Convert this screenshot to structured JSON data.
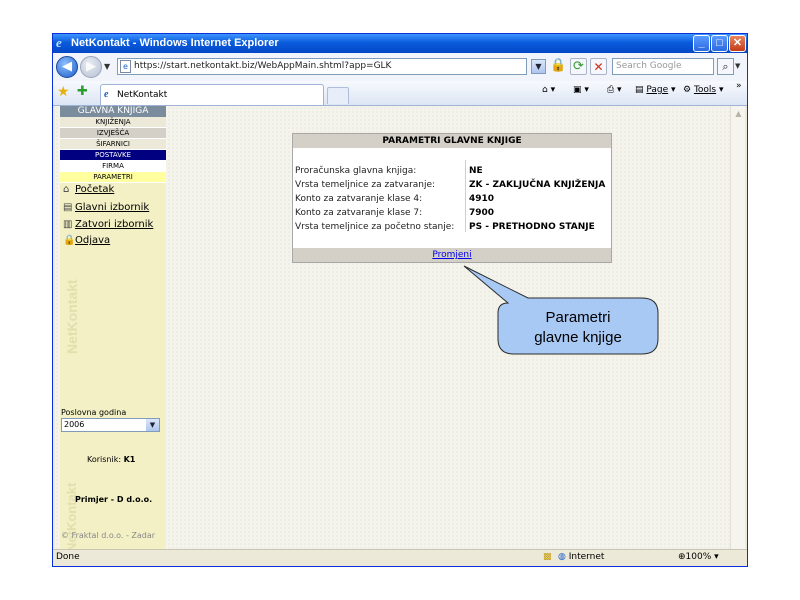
{
  "window": {
    "title": "NetKontakt - Windows Internet Explorer",
    "minimize": "_",
    "maximize": "□",
    "close": "✕"
  },
  "addressbar": {
    "url": "https://start.netkontakt.biz/WebAppMain.shtml?app=GLK",
    "search_placeholder": "Search Google"
  },
  "tabs": [
    {
      "label": "NetKontakt"
    }
  ],
  "commandbar": {
    "page_label": "Page",
    "tools_label": "Tools"
  },
  "sidebar": {
    "menu_header": "GLAVNA KNJIGA",
    "menu_items": [
      {
        "label": "KNJIŽENJA",
        "bg": "#ece9d8",
        "fg": "#000000"
      },
      {
        "label": "IZVJEŠĆA",
        "bg": "#d4d0c8",
        "fg": "#000000"
      },
      {
        "label": "ŠIFARNICI",
        "bg": "#ece9d8",
        "fg": "#000000"
      },
      {
        "label": "POSTAVKE",
        "bg": "#000080",
        "fg": "#ffffff"
      },
      {
        "label": "FIRMA",
        "bg": "#ffffff",
        "fg": "#000000"
      },
      {
        "label": "PARAMETRI",
        "bg": "#ffffa0",
        "fg": "#000000"
      }
    ],
    "links": [
      {
        "label": "Početak",
        "icon": "home-icon"
      },
      {
        "label": "Glavni izbornik",
        "icon": "menu-icon"
      },
      {
        "label": "Zatvori izbornik",
        "icon": "close-menu-icon"
      },
      {
        "label": "Odjava",
        "icon": "lock-icon"
      }
    ],
    "watermark": "NetKontakt",
    "year_label": "Poslovna godina",
    "year_value": "2006",
    "user_label": "Korisnik:",
    "user_value": "K1",
    "company": "Primjer - D d.o.o.",
    "copyright": "© Fraktal d.o.o. - Zadar"
  },
  "panel": {
    "title": "PARAMETRI GLAVNE KNJIGE",
    "rows": [
      {
        "label": "Proračunska glavna knjiga:",
        "value": "NE"
      },
      {
        "label": "Vrsta temeljnice za zatvaranje:",
        "value": "ZK - ZAKLJUČNA KNJIŽENJA"
      },
      {
        "label": "Konto za zatvaranje klase 4:",
        "value": "4910"
      },
      {
        "label": "Konto za zatvaranje klase 7:",
        "value": "7900"
      },
      {
        "label": "Vrsta temeljnice za početno stanje:",
        "value": "PS - PRETHODNO STANJE"
      }
    ],
    "action": "Promjeni"
  },
  "callout": {
    "line1": "Parametri",
    "line2": "glavne knjige",
    "fill": "#a9c9f5"
  },
  "statusbar": {
    "status": "Done",
    "zone": "Internet",
    "zoom": "100%"
  }
}
